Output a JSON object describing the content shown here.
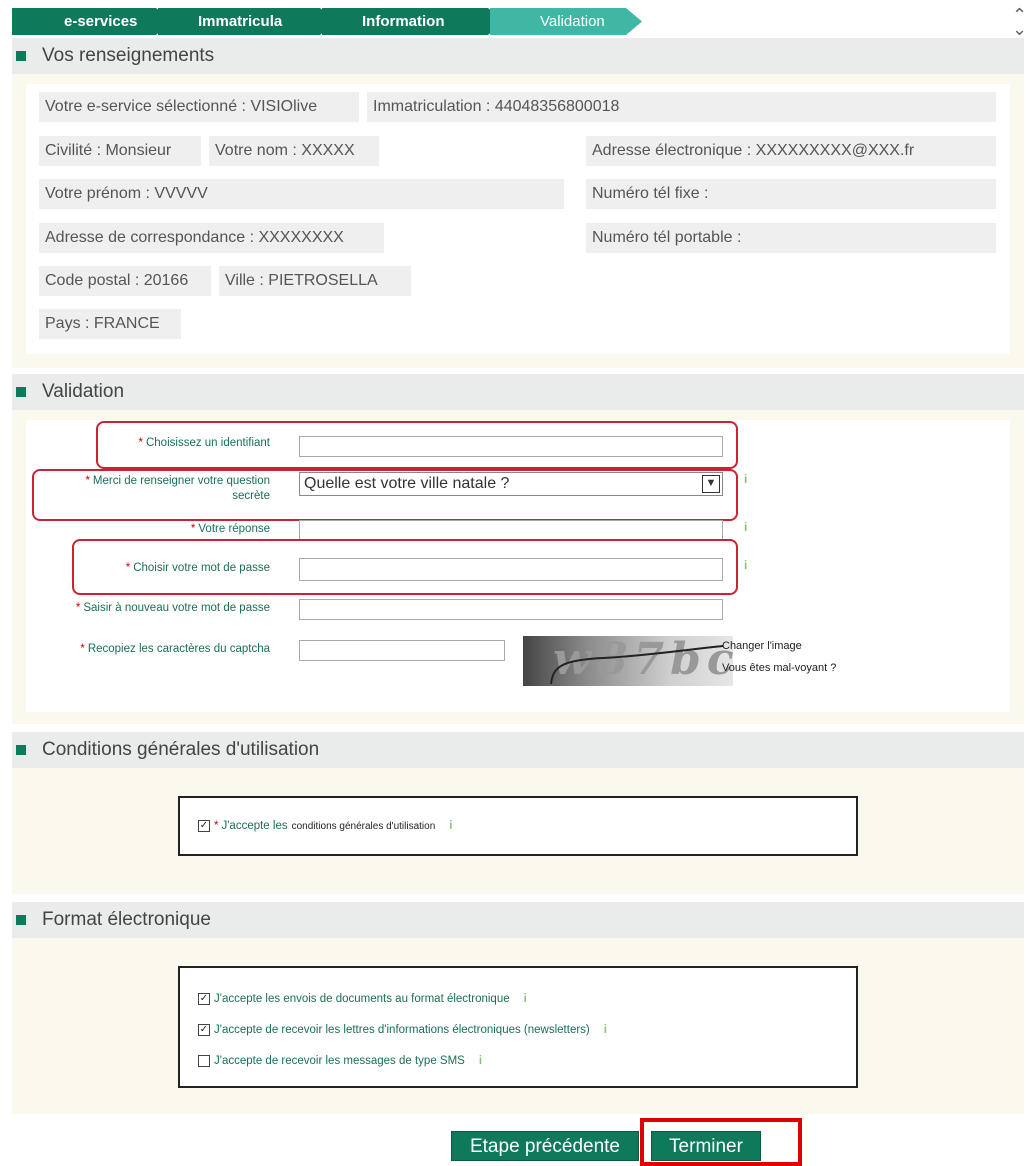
{
  "breadcrumb": [
    "e-services",
    "Immatricula",
    "Information",
    "Validation"
  ],
  "sections": {
    "renseignements": "Vos renseignements",
    "validation": "Validation",
    "cgu": "Conditions générales d'utilisation",
    "format": "Format électronique"
  },
  "info": {
    "service": "Votre e-service sélectionné : VISIOlive",
    "immat": "Immatriculation : 44048356800018",
    "civilite": "Civilité : Monsieur",
    "nom": "Votre nom : XXXXX",
    "email": "Adresse électronique : XXXXXXXXX@XXX.fr",
    "prenom": "Votre prénom : VVVVV",
    "tel_fixe": "Numéro tél fixe :",
    "adresse": "Adresse de correspondance : XXXXXXXX",
    "tel_portable": "Numéro tél portable :",
    "cp": "Code postal : 20166",
    "ville": "Ville : PIETROSELLA",
    "pays": "Pays : FRANCE"
  },
  "form": {
    "identifiant_label": "Choisissez un identifiant",
    "question_label_1": "Merci de renseigner votre question",
    "question_label_2": "secrète",
    "question_value": "Quelle est votre ville natale ?",
    "reponse_label": "Votre réponse",
    "mdp_label": "Choisir votre mot de passe",
    "mdp2_label": "Saisir à nouveau votre mot de passe",
    "captcha_label": "Recopiez les caractères du captcha",
    "captcha_text": "w87bc",
    "change_image": "Changer l'image",
    "malvoyant": "Vous êtes mal-voyant ?",
    "required": "*",
    "info": "i"
  },
  "cgu": {
    "accept": "J'accepte les",
    "link": "conditions générales d'utilisation"
  },
  "format": {
    "opt1": "J'accepte les envois de documents au format électronique",
    "opt2": "J'accepte de recevoir les lettres d'informations électroniques (newsletters)",
    "opt3": "J'accepte de recevoir les messages de type SMS"
  },
  "checks": {
    "cgu": true,
    "opt1": true,
    "opt2": true,
    "opt3": false
  },
  "buttons": {
    "prev": "Etape précédente",
    "finish": "Terminer"
  }
}
